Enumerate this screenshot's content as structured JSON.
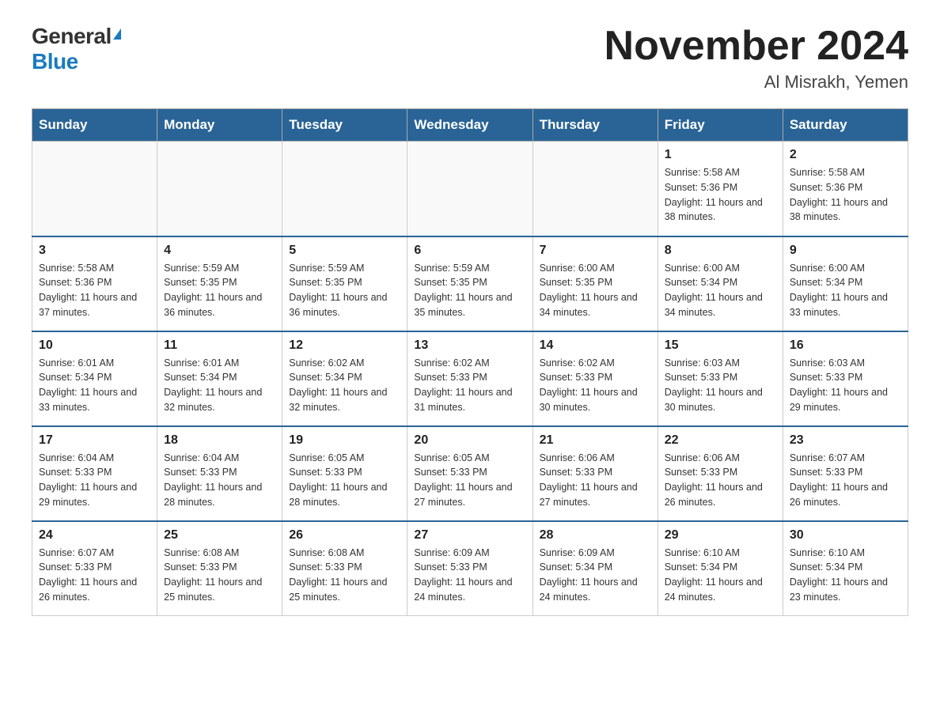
{
  "header": {
    "logo_general": "General",
    "logo_blue": "Blue",
    "month_title": "November 2024",
    "location": "Al Misrakh, Yemen"
  },
  "days_of_week": [
    "Sunday",
    "Monday",
    "Tuesday",
    "Wednesday",
    "Thursday",
    "Friday",
    "Saturday"
  ],
  "weeks": [
    [
      {
        "day": "",
        "info": ""
      },
      {
        "day": "",
        "info": ""
      },
      {
        "day": "",
        "info": ""
      },
      {
        "day": "",
        "info": ""
      },
      {
        "day": "",
        "info": ""
      },
      {
        "day": "1",
        "info": "Sunrise: 5:58 AM\nSunset: 5:36 PM\nDaylight: 11 hours and 38 minutes."
      },
      {
        "day": "2",
        "info": "Sunrise: 5:58 AM\nSunset: 5:36 PM\nDaylight: 11 hours and 38 minutes."
      }
    ],
    [
      {
        "day": "3",
        "info": "Sunrise: 5:58 AM\nSunset: 5:36 PM\nDaylight: 11 hours and 37 minutes."
      },
      {
        "day": "4",
        "info": "Sunrise: 5:59 AM\nSunset: 5:35 PM\nDaylight: 11 hours and 36 minutes."
      },
      {
        "day": "5",
        "info": "Sunrise: 5:59 AM\nSunset: 5:35 PM\nDaylight: 11 hours and 36 minutes."
      },
      {
        "day": "6",
        "info": "Sunrise: 5:59 AM\nSunset: 5:35 PM\nDaylight: 11 hours and 35 minutes."
      },
      {
        "day": "7",
        "info": "Sunrise: 6:00 AM\nSunset: 5:35 PM\nDaylight: 11 hours and 34 minutes."
      },
      {
        "day": "8",
        "info": "Sunrise: 6:00 AM\nSunset: 5:34 PM\nDaylight: 11 hours and 34 minutes."
      },
      {
        "day": "9",
        "info": "Sunrise: 6:00 AM\nSunset: 5:34 PM\nDaylight: 11 hours and 33 minutes."
      }
    ],
    [
      {
        "day": "10",
        "info": "Sunrise: 6:01 AM\nSunset: 5:34 PM\nDaylight: 11 hours and 33 minutes."
      },
      {
        "day": "11",
        "info": "Sunrise: 6:01 AM\nSunset: 5:34 PM\nDaylight: 11 hours and 32 minutes."
      },
      {
        "day": "12",
        "info": "Sunrise: 6:02 AM\nSunset: 5:34 PM\nDaylight: 11 hours and 32 minutes."
      },
      {
        "day": "13",
        "info": "Sunrise: 6:02 AM\nSunset: 5:33 PM\nDaylight: 11 hours and 31 minutes."
      },
      {
        "day": "14",
        "info": "Sunrise: 6:02 AM\nSunset: 5:33 PM\nDaylight: 11 hours and 30 minutes."
      },
      {
        "day": "15",
        "info": "Sunrise: 6:03 AM\nSunset: 5:33 PM\nDaylight: 11 hours and 30 minutes."
      },
      {
        "day": "16",
        "info": "Sunrise: 6:03 AM\nSunset: 5:33 PM\nDaylight: 11 hours and 29 minutes."
      }
    ],
    [
      {
        "day": "17",
        "info": "Sunrise: 6:04 AM\nSunset: 5:33 PM\nDaylight: 11 hours and 29 minutes."
      },
      {
        "day": "18",
        "info": "Sunrise: 6:04 AM\nSunset: 5:33 PM\nDaylight: 11 hours and 28 minutes."
      },
      {
        "day": "19",
        "info": "Sunrise: 6:05 AM\nSunset: 5:33 PM\nDaylight: 11 hours and 28 minutes."
      },
      {
        "day": "20",
        "info": "Sunrise: 6:05 AM\nSunset: 5:33 PM\nDaylight: 11 hours and 27 minutes."
      },
      {
        "day": "21",
        "info": "Sunrise: 6:06 AM\nSunset: 5:33 PM\nDaylight: 11 hours and 27 minutes."
      },
      {
        "day": "22",
        "info": "Sunrise: 6:06 AM\nSunset: 5:33 PM\nDaylight: 11 hours and 26 minutes."
      },
      {
        "day": "23",
        "info": "Sunrise: 6:07 AM\nSunset: 5:33 PM\nDaylight: 11 hours and 26 minutes."
      }
    ],
    [
      {
        "day": "24",
        "info": "Sunrise: 6:07 AM\nSunset: 5:33 PM\nDaylight: 11 hours and 26 minutes."
      },
      {
        "day": "25",
        "info": "Sunrise: 6:08 AM\nSunset: 5:33 PM\nDaylight: 11 hours and 25 minutes."
      },
      {
        "day": "26",
        "info": "Sunrise: 6:08 AM\nSunset: 5:33 PM\nDaylight: 11 hours and 25 minutes."
      },
      {
        "day": "27",
        "info": "Sunrise: 6:09 AM\nSunset: 5:33 PM\nDaylight: 11 hours and 24 minutes."
      },
      {
        "day": "28",
        "info": "Sunrise: 6:09 AM\nSunset: 5:34 PM\nDaylight: 11 hours and 24 minutes."
      },
      {
        "day": "29",
        "info": "Sunrise: 6:10 AM\nSunset: 5:34 PM\nDaylight: 11 hours and 24 minutes."
      },
      {
        "day": "30",
        "info": "Sunrise: 6:10 AM\nSunset: 5:34 PM\nDaylight: 11 hours and 23 minutes."
      }
    ]
  ]
}
